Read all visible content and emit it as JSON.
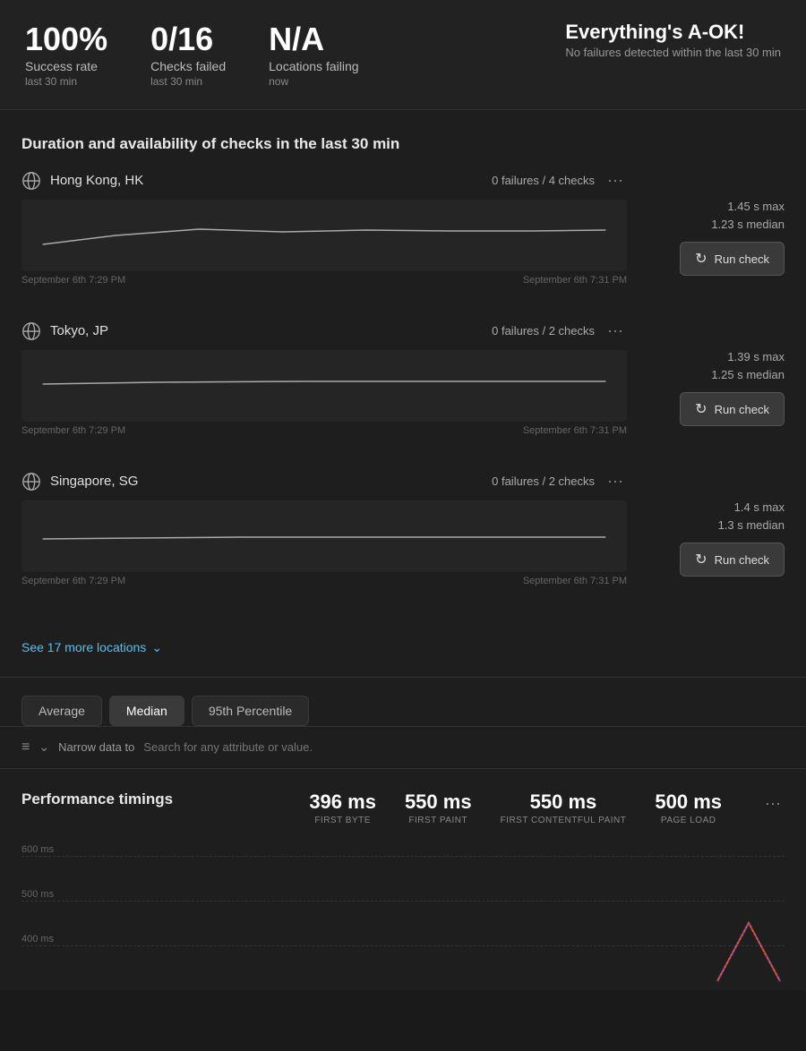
{
  "stats": {
    "success_rate": {
      "value": "100%",
      "label": "Success rate",
      "sublabel": "last 30 min"
    },
    "checks_failed": {
      "value": "0/16",
      "label": "Checks failed",
      "sublabel": "last 30 min"
    },
    "locations_failing": {
      "value": "N/A",
      "label": "Locations failing",
      "sublabel": "now"
    },
    "status_ok": {
      "value": "Everything's A-OK!",
      "label": "No failures detected within the last 30 min"
    }
  },
  "section_title": "Duration and availability of checks in the last 30 min",
  "locations": [
    {
      "name": "Hong Kong, HK",
      "checks": "0 failures / 4 checks",
      "time_start": "September 6th 7:29 PM",
      "time_end": "September 6th 7:31 PM",
      "max": "1.45 s max",
      "median": "1.23 s median",
      "run_label": "Run check"
    },
    {
      "name": "Tokyo, JP",
      "checks": "0 failures / 2 checks",
      "time_start": "September 6th 7:29 PM",
      "time_end": "September 6th 7:31 PM",
      "max": "1.39 s max",
      "median": "1.25 s median",
      "run_label": "Run check"
    },
    {
      "name": "Singapore, SG",
      "checks": "0 failures / 2 checks",
      "time_start": "September 6th 7:29 PM",
      "time_end": "September 6th 7:31 PM",
      "max": "1.4 s max",
      "median": "1.3 s median",
      "run_label": "Run check"
    }
  ],
  "see_more": {
    "label": "See 17 more locations",
    "icon": "chevron-down"
  },
  "tabs": {
    "items": [
      {
        "label": "Average",
        "active": false
      },
      {
        "label": "Median",
        "active": true
      },
      {
        "label": "95th Percentile",
        "active": false
      }
    ]
  },
  "filter": {
    "label": "Narrow data to",
    "placeholder": "Search for any attribute or value."
  },
  "performance": {
    "title": "Performance timings",
    "metrics": [
      {
        "value": "396 ms",
        "label": "FIRST BYTE"
      },
      {
        "value": "550 ms",
        "label": "FIRST PAINT"
      },
      {
        "value": "550 ms",
        "label": "FIRST CONTENTFUL PAINT"
      },
      {
        "value": "500 ms",
        "label": "PAGE LOAD"
      }
    ],
    "grid_labels": [
      "600 ms",
      "500 ms",
      "400 ms"
    ]
  }
}
